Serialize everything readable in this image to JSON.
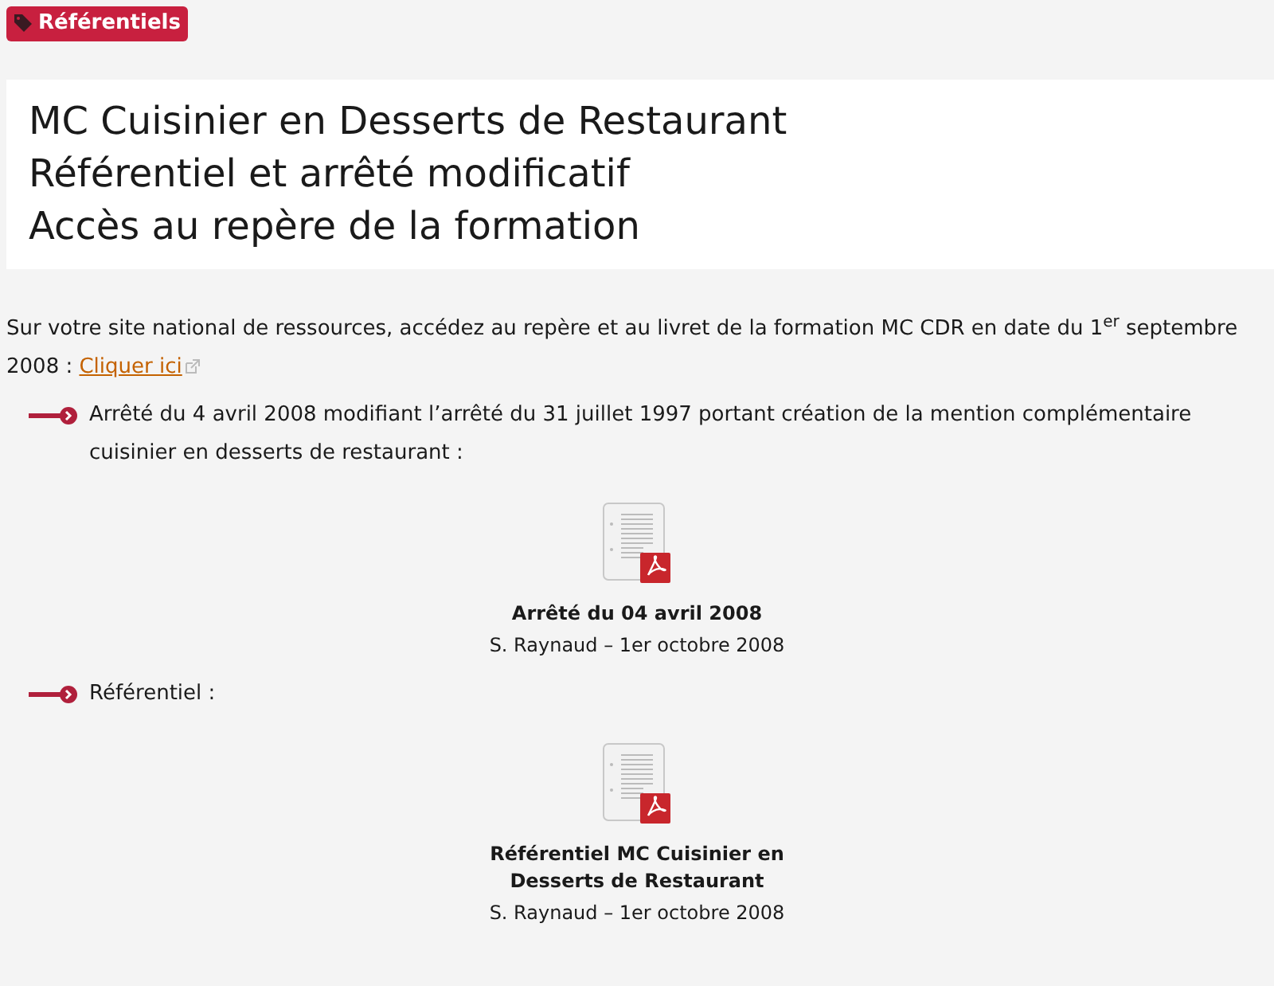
{
  "badge": {
    "label": "Référentiels"
  },
  "title_lines": [
    "MC Cuisinier en Desserts de Restaurant",
    "Référentiel et arrêté modificatif",
    "Accès au repère de la formation"
  ],
  "intro": {
    "text": "Sur votre site national de ressources, accédez au repère et au livret de la formation MC CDR en date du 1$^{er}$ septembre 2008 :",
    "link": "Cliquer ici"
  },
  "sections": [
    {
      "text": "Arrêté du 4 avril 2008 modifiant l’arrêté du 31 juillet 1997 portant création de la mention complémentaire cuisinier en desserts de restaurant :",
      "document": {
        "title": "Arrêté du 04 avril 2008",
        "meta": "S. Raynaud – 1er octobre 2008"
      }
    },
    {
      "text": "Référentiel :",
      "document": {
        "title": "Référentiel MC Cuisinier en Desserts de Restaurant",
        "meta": "S. Raynaud – 1er octobre 2008"
      }
    }
  ]
}
